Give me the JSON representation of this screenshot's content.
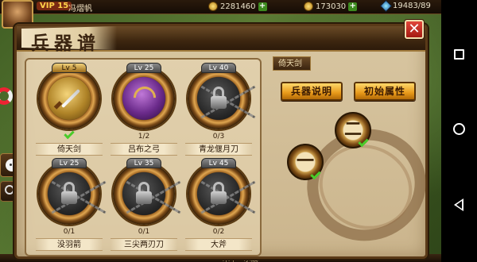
{
  "hud": {
    "vip": "VIP 15",
    "player_name": "冯熠帆",
    "resource_1": "2281460",
    "resource_2": "173030",
    "resource_3": "19483/89"
  },
  "panel": {
    "title": "兵器谱",
    "close_symbol": "✕"
  },
  "weapons": [
    {
      "name": "倚天剑",
      "level": "Lv 5",
      "count": "",
      "status": "owned",
      "icon": "sword-icon"
    },
    {
      "name": "吕布之弓",
      "level": "Lv 25",
      "count": "1/2",
      "status": "available",
      "icon": "bow-icon"
    },
    {
      "name": "青龙偃月刀",
      "level": "Lv 40",
      "count": "0/3",
      "status": "locked",
      "icon": "lock-icon"
    },
    {
      "name": "没羽箭",
      "level": "Lv 25",
      "count": "0/1",
      "status": "locked",
      "icon": "lock-icon"
    },
    {
      "name": "三尖两刃刀",
      "level": "Lv 35",
      "count": "0/1",
      "status": "locked",
      "icon": "lock-icon"
    },
    {
      "name": "大斧",
      "level": "Lv 45",
      "count": "0/2",
      "status": "locked",
      "icon": "lock-icon"
    }
  ],
  "detail": {
    "selected_name": "倚天剑",
    "btn_description": "兵器说明",
    "btn_attributes": "初始属性",
    "stage_1": "一",
    "stage_2": "二"
  },
  "bottom_text": "木华 · 水战",
  "colors": {
    "panel_bg": "#cbb58d",
    "frame_dark": "#5a3a18",
    "button_orange": "#e89a1a",
    "close_red": "#c8281c",
    "check_green": "#4acb2a"
  }
}
